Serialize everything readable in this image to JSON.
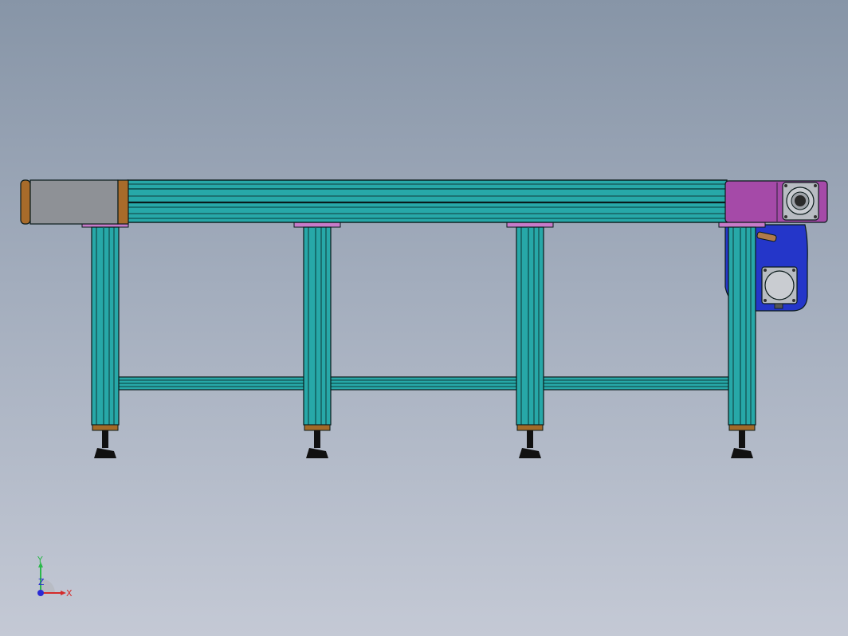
{
  "viewport": {
    "background_top": "#8795a7",
    "background_bottom": "#c4c9d5"
  },
  "colors": {
    "profile": "#27a8a8",
    "profile_dark": "#11605f",
    "outline": "#0a1a1a",
    "idler_guard": "#8e9196",
    "end_cap": "#a86b2a",
    "drive_housing": "#a54aa8",
    "motor_bracket": "#2436c9",
    "leg_mount": "#c77bc9",
    "foot_collar": "#a36a28",
    "foot_base": "#111111",
    "motor_grey": "#b8bcc2",
    "handle": "#b07a4a"
  },
  "triad": {
    "x_label": "X",
    "y_label": "Y",
    "z_label": "Z",
    "x_color": "#d42a2a",
    "y_color": "#2ab84a",
    "z_color": "#2a2ad4"
  }
}
